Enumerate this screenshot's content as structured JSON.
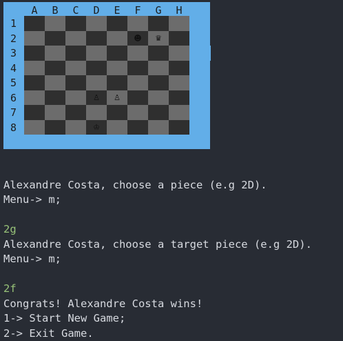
{
  "board": {
    "columns": [
      "A",
      "B",
      "C",
      "D",
      "E",
      "F",
      "G",
      "H"
    ],
    "rows": [
      "1",
      "2",
      "3",
      "4",
      "5",
      "6",
      "7",
      "8"
    ],
    "pieces": [
      {
        "square": "F2",
        "glyph": "☻",
        "name": "dark-piece"
      },
      {
        "square": "G2",
        "glyph": "♛",
        "name": "queen-piece"
      },
      {
        "square": "D6",
        "glyph": "♙",
        "name": "pawn-piece"
      },
      {
        "square": "E6",
        "glyph": "♙",
        "name": "pawn-piece"
      },
      {
        "square": "D8",
        "glyph": "♔",
        "name": "king-piece"
      }
    ]
  },
  "console": {
    "lines": [
      {
        "text": "",
        "type": "output"
      },
      {
        "text": "Alexandre Costa, choose a piece (e.g 2D).",
        "type": "output"
      },
      {
        "text": "Menu-> m;",
        "type": "output"
      },
      {
        "text": "",
        "type": "output"
      },
      {
        "text": "2g",
        "type": "input"
      },
      {
        "text": "Alexandre Costa, choose a target piece (e.g 2D).",
        "type": "output"
      },
      {
        "text": "Menu-> m;",
        "type": "output"
      },
      {
        "text": "",
        "type": "output"
      },
      {
        "text": "2f",
        "type": "input"
      },
      {
        "text": "Congrats! Alexandre Costa wins!",
        "type": "output"
      },
      {
        "text": "1-> Start New Game;",
        "type": "output"
      },
      {
        "text": "2-> Exit Game.",
        "type": "output"
      }
    ]
  },
  "colors": {
    "background": "#282c34",
    "board_frame": "#62aee8",
    "dark_square": "#2f2f2f",
    "light_square": "#6c6c6c",
    "input_text": "#98c379",
    "output_text": "#d7dae0"
  }
}
